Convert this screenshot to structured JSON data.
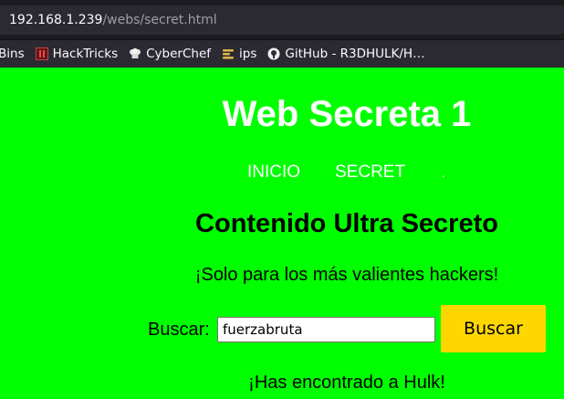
{
  "browser": {
    "url_host": "192.168.1.239",
    "url_path": "/webs/secret.html"
  },
  "bookmarks": [
    {
      "label": "Bins",
      "icon": "none"
    },
    {
      "label": "HackTricks",
      "icon": "hacktricks-icon"
    },
    {
      "label": "CyberChef",
      "icon": "chef-hat-icon"
    },
    {
      "label": "ips",
      "icon": "ips-icon"
    },
    {
      "label": "GitHub - R3DHULK/H…",
      "icon": "github-icon"
    }
  ],
  "page": {
    "title": "Web Secreta 1",
    "nav": {
      "inicio": "INICIO",
      "secret": "SECRET",
      "dot": "."
    },
    "subtitle": "Contenido Ultra Secreto",
    "tagline": "¡Solo para los más valientes hackers!",
    "search": {
      "label": "Buscar:",
      "value": "fuerzabruta",
      "button": "Buscar"
    },
    "result": "¡Has encontrado a Hulk!"
  },
  "colors": {
    "page_background": "#00ff00",
    "button_background": "#ffd700",
    "title_color": "#ffffff"
  }
}
